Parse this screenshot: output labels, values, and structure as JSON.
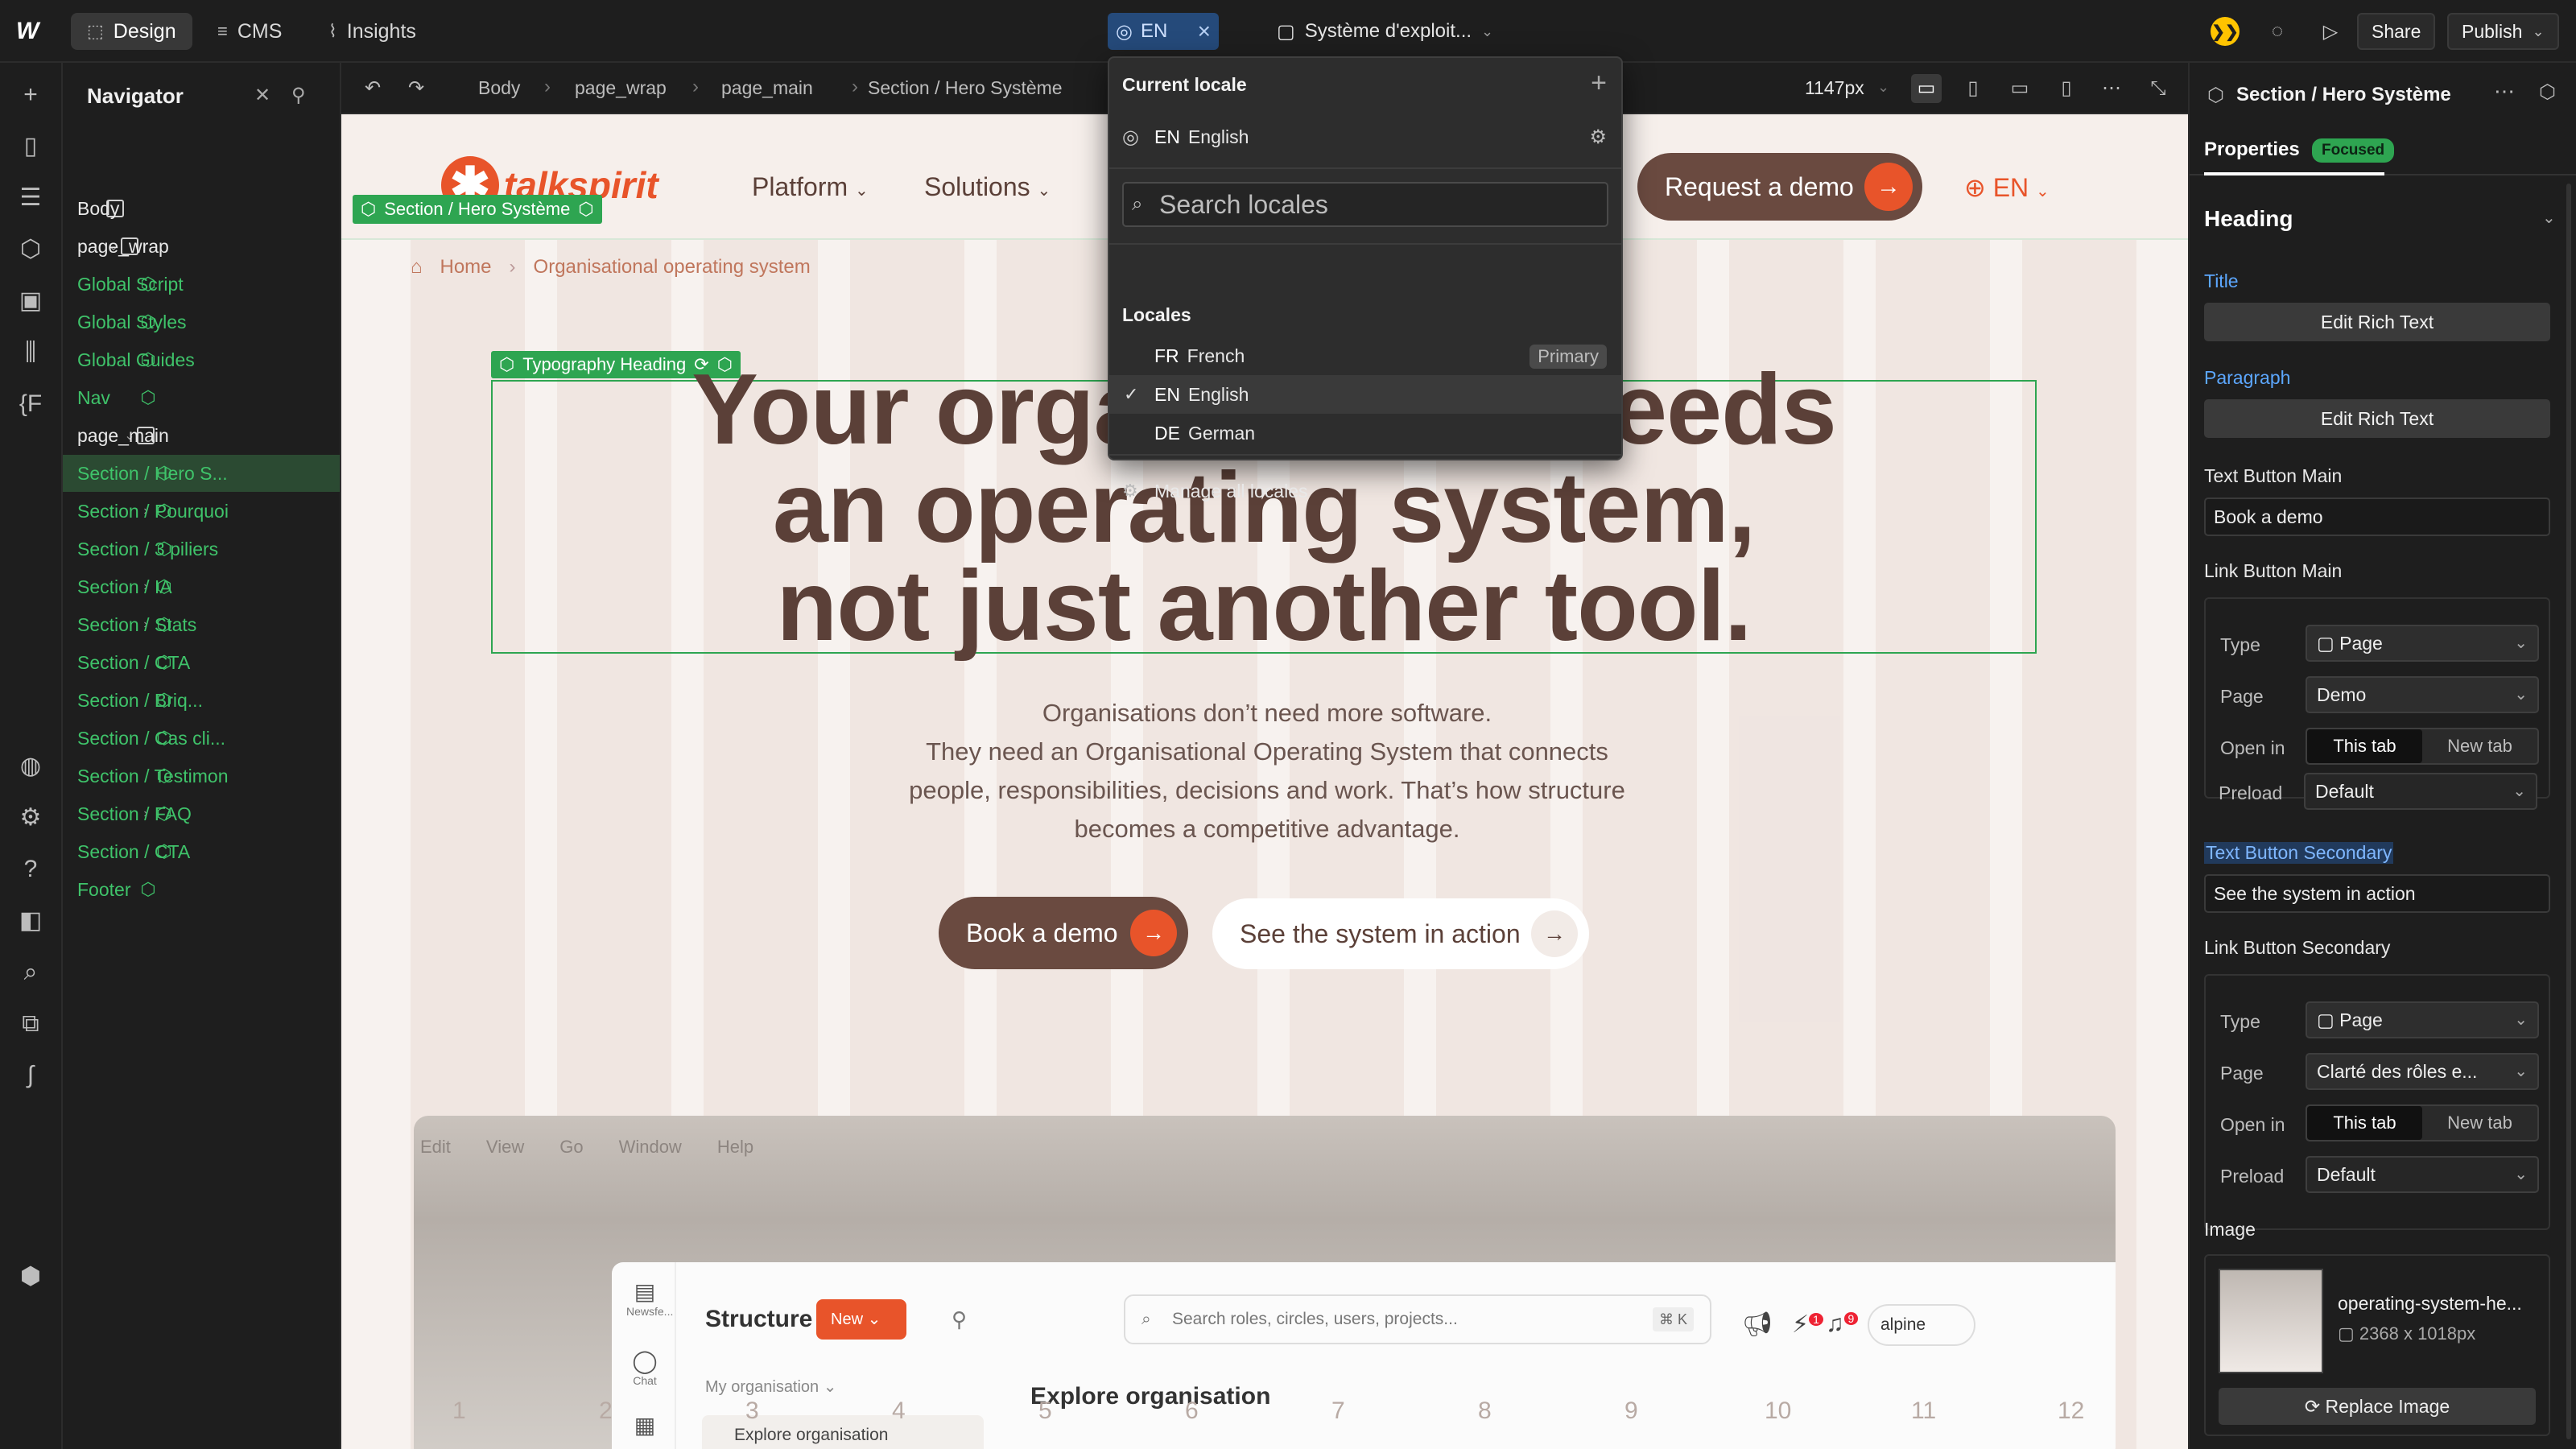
{
  "topbar": {
    "modes": [
      {
        "label": "Design",
        "icon": "cursor-icon"
      },
      {
        "label": "CMS",
        "icon": "database-icon"
      },
      {
        "label": "Insights",
        "icon": "chart-icon"
      }
    ],
    "locale_pill": "EN",
    "page_name": "Système d'exploit...",
    "share_label": "Share",
    "publish_label": "Publish"
  },
  "navigator": {
    "title": "Navigator",
    "items": [
      {
        "label": "Body",
        "level": 0,
        "kind": "box",
        "caret": ""
      },
      {
        "label": "page_wrap",
        "level": 1,
        "kind": "box",
        "caret": "v"
      },
      {
        "label": "Global Script",
        "level": 2,
        "kind": "component",
        "caret": ""
      },
      {
        "label": "Global Styles",
        "level": 2,
        "kind": "component",
        "caret": ""
      },
      {
        "label": "Global Guides",
        "level": 2,
        "kind": "component",
        "caret": ""
      },
      {
        "label": "Nav",
        "level": 2,
        "kind": "component",
        "caret": ""
      },
      {
        "label": "page_main",
        "level": 2,
        "kind": "box",
        "caret": "v"
      },
      {
        "label": "Section / Hero S...",
        "level": 3,
        "kind": "component",
        "caret": "",
        "selected": true
      },
      {
        "label": "Section / Pourquoi",
        "level": 3,
        "kind": "component",
        "caret": ">"
      },
      {
        "label": "Section / 3 piliers",
        "level": 3,
        "kind": "component",
        "caret": ""
      },
      {
        "label": "Section / IA",
        "level": 3,
        "kind": "component",
        "caret": ">"
      },
      {
        "label": "Section / Stats",
        "level": 3,
        "kind": "component",
        "caret": ">"
      },
      {
        "label": "Section / CTA",
        "level": 3,
        "kind": "component",
        "caret": ""
      },
      {
        "label": "Section / Briq...",
        "level": 3,
        "kind": "component",
        "caret": ""
      },
      {
        "label": "Section / Cas cli...",
        "level": 3,
        "kind": "component",
        "caret": ""
      },
      {
        "label": "Section / Testimon",
        "level": 3,
        "kind": "component",
        "caret": ""
      },
      {
        "label": "Section / FAQ",
        "level": 3,
        "kind": "component",
        "caret": ">"
      },
      {
        "label": "Section / CTA",
        "level": 3,
        "kind": "component",
        "caret": ""
      },
      {
        "label": "Footer",
        "level": 2,
        "kind": "component",
        "caret": ""
      }
    ]
  },
  "canvas_bar": {
    "breadcrumbs": [
      "Body",
      "page_wrap",
      "page_main",
      "Section / Hero Système"
    ],
    "width_label": "1147px"
  },
  "locale_menu": {
    "current_heading": "Current locale",
    "current_code": "EN",
    "current_name": "English",
    "search_placeholder": "Search locales",
    "locales_heading": "Locales",
    "locales": [
      {
        "code": "FR",
        "name": "French",
        "badge": "Primary",
        "checked": false
      },
      {
        "code": "EN",
        "name": "English",
        "badge": "",
        "checked": true
      },
      {
        "code": "DE",
        "name": "German",
        "badge": "",
        "checked": false
      }
    ],
    "manage_label": "Manage all locales"
  },
  "site": {
    "brand": "talkspirit",
    "nav": [
      "Platform",
      "Solutions"
    ],
    "demo_button": "Request a demo",
    "lang": "EN",
    "section_tag": "Section / Hero Système",
    "heading_tag": "Typography Heading",
    "breadcrumb_home": "Home",
    "breadcrumb_current": "Organisational operating system",
    "hero_title_lines": [
      "Your organisation needs",
      "an operating system,",
      "not just another tool."
    ],
    "hero_sub_lines": [
      "Organisations don’t need more software.",
      "They need an Organisational Operating System that connects",
      "people, responsibilities, decisions and work. That’s how structure",
      "becomes a competitive advantage."
    ],
    "cta_main": "Book a demo",
    "cta_secondary": "See the system in action",
    "col_numbers": [
      "1",
      "2",
      "3",
      "4",
      "5",
      "6",
      "7",
      "8",
      "9",
      "10",
      "11",
      "12"
    ],
    "shot": {
      "menu": [
        "Edit",
        "View",
        "Go",
        "Window",
        "Help"
      ],
      "side_items": [
        "Newsfe...",
        "Chat"
      ],
      "title": "Structure",
      "new_button": "New",
      "search_placeholder": "Search roles, circles, users, projects...",
      "shortcut": "⌘ K",
      "org": "My organisation",
      "explore": "Explore organisation",
      "explore_item": "Explore organisation",
      "user": "alpine",
      "notif_counts": [
        "1",
        "9"
      ]
    }
  },
  "right_panel": {
    "title": "Section / Hero Système",
    "tab": "Properties",
    "focused_badge": "Focused",
    "section": "Heading",
    "title_label": "Title",
    "edit_rich_text": "Edit Rich Text",
    "paragraph_label": "Paragraph",
    "text_button_main_label": "Text Button Main",
    "text_button_main_value": "Book a demo",
    "link_button_main_label": "Link Button Main",
    "text_button_secondary_label": "Text Button Secondary",
    "text_button_secondary_value": "See the system in action",
    "link_button_secondary_label": "Link Button Secondary",
    "link_main": {
      "type": "Page",
      "page": "Demo",
      "open_this": "This tab",
      "open_new": "New tab",
      "preload": "Default"
    },
    "link_secondary": {
      "type": "Page",
      "page": "Clarté des rôles e...",
      "open_this": "This tab",
      "open_new": "New tab",
      "preload": "Default"
    },
    "row_labels": {
      "type": "Type",
      "page": "Page",
      "open_in": "Open in",
      "preload": "Preload"
    },
    "image_label": "Image",
    "image_name": "operating-system-he...",
    "image_size": "2368 x 1018px",
    "replace_image": "Replace Image"
  }
}
